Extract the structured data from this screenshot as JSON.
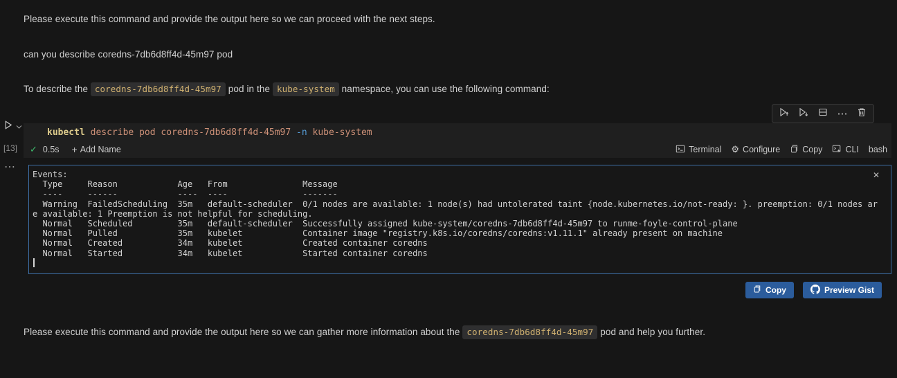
{
  "page": {
    "p1": "Please execute this command and provide the output here so we can proceed with the next steps.",
    "p2": "can you describe coredns-7db6d8ff4d-45m97 pod",
    "p3": {
      "before": "To describe the ",
      "code1": "coredns-7db6d8ff4d-45m97",
      "between": " pod in the ",
      "code2": "kube-system",
      "after": " namespace, you can use the following command:"
    },
    "p4": {
      "before": "Please execute this command and provide the output here so we can gather more information about the ",
      "code": "coredns-7db6d8ff4d-45m97",
      "after": " pod and help you further."
    }
  },
  "cell": {
    "language": "bash",
    "code_tokens": {
      "cmd": "kubectl",
      "args": " describe pod coredns-7db6d8ff4d-45m97 ",
      "flag": "-n",
      "namespace": " kube-system"
    },
    "execution_count": "[13]",
    "duration": "0.5s",
    "add_name_label": "Add Name",
    "toolbar_icons": [
      "execute-above",
      "execute-cell-and-below",
      "split-cell",
      "more-actions",
      "delete-cell"
    ],
    "statusbar_right": [
      {
        "icon": "terminal-icon",
        "label": "Terminal"
      },
      {
        "icon": "gear-icon",
        "label": "Configure"
      },
      {
        "icon": "copy-icon",
        "label": "Copy"
      },
      {
        "icon": "cli-icon",
        "label": "CLI"
      },
      {
        "icon": "",
        "label": "bash"
      }
    ]
  },
  "output": {
    "lines": [
      "Events:",
      "  Type     Reason            Age   From               Message",
      "  ----     ------            ----  ----               -------",
      "  Warning  FailedScheduling  35m   default-scheduler  0/1 nodes are available: 1 node(s) had untolerated taint {node.kubernetes.io/not-ready: }. preemption: 0/1 nodes ar",
      "e available: 1 Preemption is not helpful for scheduling.",
      "  Normal   Scheduled         35m   default-scheduler  Successfully assigned kube-system/coredns-7db6d8ff4d-45m97 to runme-foyle-control-plane",
      "  Normal   Pulled            35m   kubelet            Container image \"registry.k8s.io/coredns/coredns:v1.11.1\" already present on machine",
      "  Normal   Created           34m   kubelet            Created container coredns",
      "  Normal   Started           34m   kubelet            Started container coredns"
    ]
  },
  "actions": {
    "copy_label": "Copy",
    "preview_gist_label": "Preview Gist"
  },
  "colors": {
    "background": "#161616",
    "cell_background": "#1f1f1f",
    "output_focus_border": "#3e70a8",
    "button_accent": "#2b5c9c",
    "inline_code_text": "#d0b170",
    "token_command": "#decc8c",
    "token_string": "#ce9178",
    "token_flag": "#569cd6",
    "success_green": "#3fbf6f"
  }
}
